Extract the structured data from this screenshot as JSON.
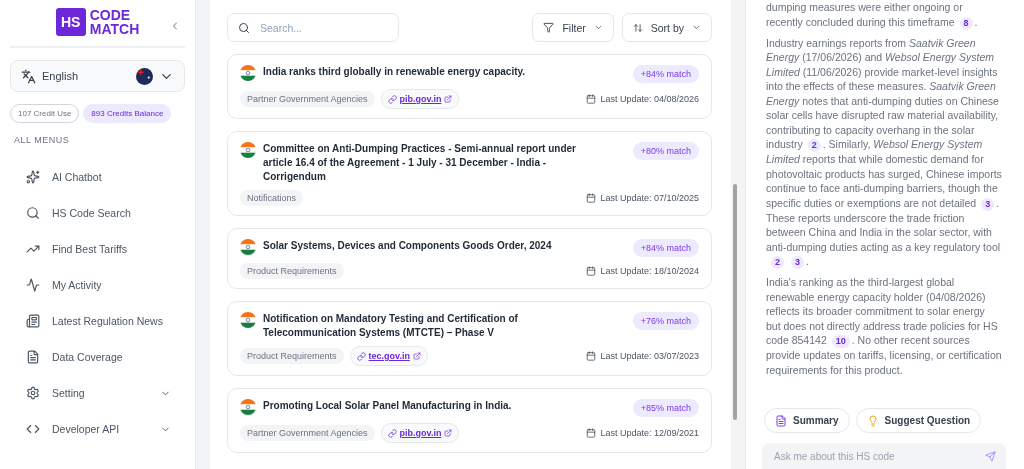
{
  "sidebar": {
    "logo": {
      "mark": "HS",
      "line1": "CODE",
      "line2": "MATCH"
    },
    "language": {
      "label": "English"
    },
    "credits": [
      {
        "text": "107 Credit Use",
        "kind": "outline"
      },
      {
        "text": "893 Credits Balance",
        "kind": "filled"
      }
    ],
    "section_title": "ALL MENUS",
    "items": [
      {
        "label": "AI Chatbot",
        "expandable": false
      },
      {
        "label": "HS Code Search",
        "expandable": false
      },
      {
        "label": "Find Best Tariffs",
        "expandable": false
      },
      {
        "label": "My Activity",
        "expandable": false
      },
      {
        "label": "Latest Regulation News",
        "expandable": false
      },
      {
        "label": "Data Coverage",
        "expandable": false
      },
      {
        "label": "Setting",
        "expandable": true
      },
      {
        "label": "Developer API",
        "expandable": true
      }
    ]
  },
  "results": {
    "search": {
      "placeholder": "Search..."
    },
    "filter": "Filter",
    "sort": "Sort by",
    "items": [
      {
        "title": "India ranks third globally in renewable energy capacity.",
        "match": "+84% match",
        "tag": "Partner Government Agencies",
        "link": "pib.gov.in",
        "date": "Last Update: 04/08/2026"
      },
      {
        "title": "Committee on Anti-Dumping Practices - Semi-annual report under article 16.4 of the Agreement - 1 July - 31 December - India - Corrigendum",
        "match": "+80% match",
        "tag": "Notifications",
        "date": "Last Update: 07/10/2025"
      },
      {
        "title": "Solar Systems, Devices and Components Goods Order, 2024",
        "match": "+84% match",
        "tag": "Product Requirements",
        "date": "Last Update: 18/10/2024"
      },
      {
        "title": "Notification on Mandatory Testing and Certification of Telecommunication Systems (MTCTE) – Phase V",
        "match": "+76% match",
        "tag": "Product Requirements",
        "link": "tec.gov.in",
        "date": "Last Update: 03/07/2023"
      },
      {
        "title": "Promoting Local Solar Panel Manufacturing in India.",
        "match": "+85% match",
        "tag": "Partner Government Agencies",
        "link": "pib.gov.in",
        "date": "Last Update: 12/09/2021"
      }
    ]
  },
  "chat": {
    "paragraphs": [
      [
        {
          "kind": "text",
          "text": "dumping measures were either ongoing or recently concluded during this timeframe"
        },
        {
          "kind": "cite",
          "text": "8"
        },
        {
          "kind": "text",
          "text": "."
        }
      ],
      [
        {
          "kind": "text",
          "text": "Industry earnings reports from *Saatvik Green Energy* (17/06/2026) and *Websol Energy System Limited* (11/06/2026) provide market-level insights into the effects of these measures. *Saatvik Green Energy* notes that anti-dumping duties on Chinese solar cells have disrupted raw material availability, contributing to capacity overhang in the solar industry"
        },
        {
          "kind": "cite",
          "text": "2"
        },
        {
          "kind": "text",
          "text": ". Similarly, *Websol Energy System Limited* reports that while domestic demand for photovoltaic products has surged, Chinese imports continue to face anti-dumping barriers, though the specific duties or exemptions are not detailed"
        },
        {
          "kind": "cite",
          "text": "3"
        },
        {
          "kind": "text",
          "text": ". These reports underscore the trade friction between China and India in the solar sector, with anti-dumping duties acting as a key regulatory tool"
        },
        {
          "kind": "cite",
          "text": "2"
        },
        {
          "kind": "cite",
          "text": "3"
        },
        {
          "kind": "text",
          "text": "."
        }
      ],
      [
        {
          "kind": "text",
          "text": "India's ranking as the third-largest global renewable energy capacity holder (04/08/2026) reflects its broader commitment to solar energy but does not directly address trade policies for HS code 854142"
        },
        {
          "kind": "cite",
          "text": "10"
        },
        {
          "kind": "text",
          "text": ". No other recent sources provide updates on tariffs, licensing, or certification requirements for this product."
        }
      ]
    ],
    "actions": [
      "Summary",
      "Suggest Question"
    ],
    "input": {
      "placeholder": "Ask me about this HS code"
    }
  }
}
